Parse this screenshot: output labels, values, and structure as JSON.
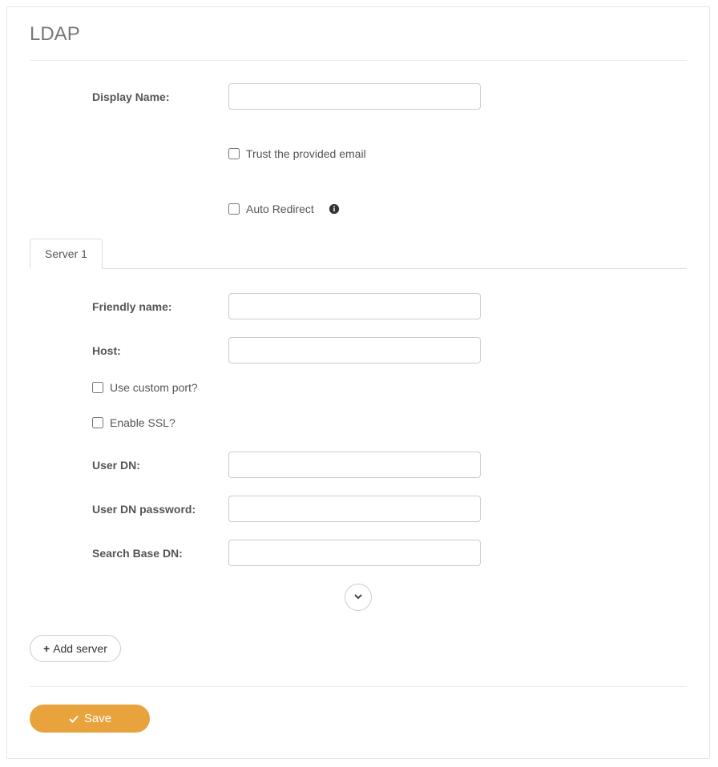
{
  "page": {
    "title": "LDAP"
  },
  "fields": {
    "displayName": {
      "label": "Display Name:",
      "value": ""
    },
    "trustEmail": {
      "label": "Trust the provided email",
      "checked": false
    },
    "autoRedirect": {
      "label": "Auto Redirect",
      "checked": false
    },
    "friendlyName": {
      "label": "Friendly name:",
      "value": ""
    },
    "host": {
      "label": "Host:",
      "value": ""
    },
    "customPort": {
      "label": "Use custom port?",
      "checked": false
    },
    "enableSsl": {
      "label": "Enable SSL?",
      "checked": false
    },
    "userDn": {
      "label": "User DN:",
      "value": ""
    },
    "userDnPassword": {
      "label": "User DN password:",
      "value": ""
    },
    "searchBaseDn": {
      "label": "Search Base DN:",
      "value": ""
    }
  },
  "tabs": {
    "server1": "Server 1"
  },
  "buttons": {
    "addServer": "Add server",
    "save": "Save"
  }
}
